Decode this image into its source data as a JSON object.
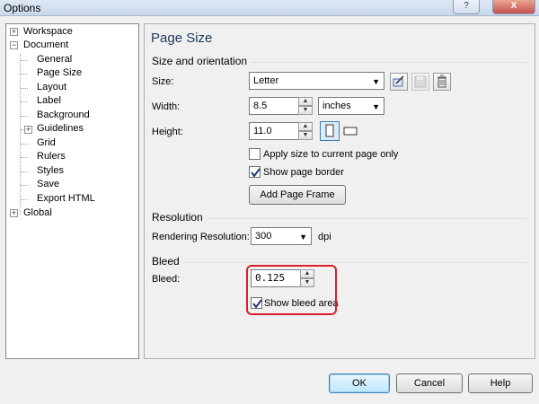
{
  "window": {
    "title": "Options",
    "help_glyph": "?",
    "close_glyph": "X"
  },
  "tree": {
    "items": [
      {
        "label": "Workspace",
        "toggle": "+"
      },
      {
        "label": "Document",
        "toggle": "−"
      },
      {
        "label": "General"
      },
      {
        "label": "Page Size"
      },
      {
        "label": "Layout"
      },
      {
        "label": "Label"
      },
      {
        "label": "Background"
      },
      {
        "label": "Guidelines",
        "toggle": "+"
      },
      {
        "label": "Grid"
      },
      {
        "label": "Rulers"
      },
      {
        "label": "Styles"
      },
      {
        "label": "Save"
      },
      {
        "label": "Export HTML"
      },
      {
        "label": "Global",
        "toggle": "+"
      }
    ]
  },
  "page": {
    "title": "Page Size",
    "size_orientation": {
      "heading": "Size and orientation",
      "size_label": "Size:",
      "size_value": "Letter",
      "width_label": "Width:",
      "width_value": "8.5",
      "units_value": "inches",
      "height_label": "Height:",
      "height_value": "11.0",
      "apply_current_label": "Apply size to current page only",
      "apply_current_checked": false,
      "show_border_label": "Show page border",
      "show_border_checked": true,
      "add_frame_label": "Add Page Frame"
    },
    "resolution": {
      "heading": "Resolution",
      "label": "Rendering Resolution:",
      "value": "300",
      "unit": "dpi"
    },
    "bleed": {
      "heading": "Bleed",
      "label": "Bleed:",
      "value": "0.125",
      "show_label": "Show bleed area",
      "show_checked": true
    }
  },
  "footer": {
    "ok": "OK",
    "cancel": "Cancel",
    "help": "Help"
  },
  "colors": {
    "highlight": "#d9202a",
    "heading": "#1e395b"
  }
}
